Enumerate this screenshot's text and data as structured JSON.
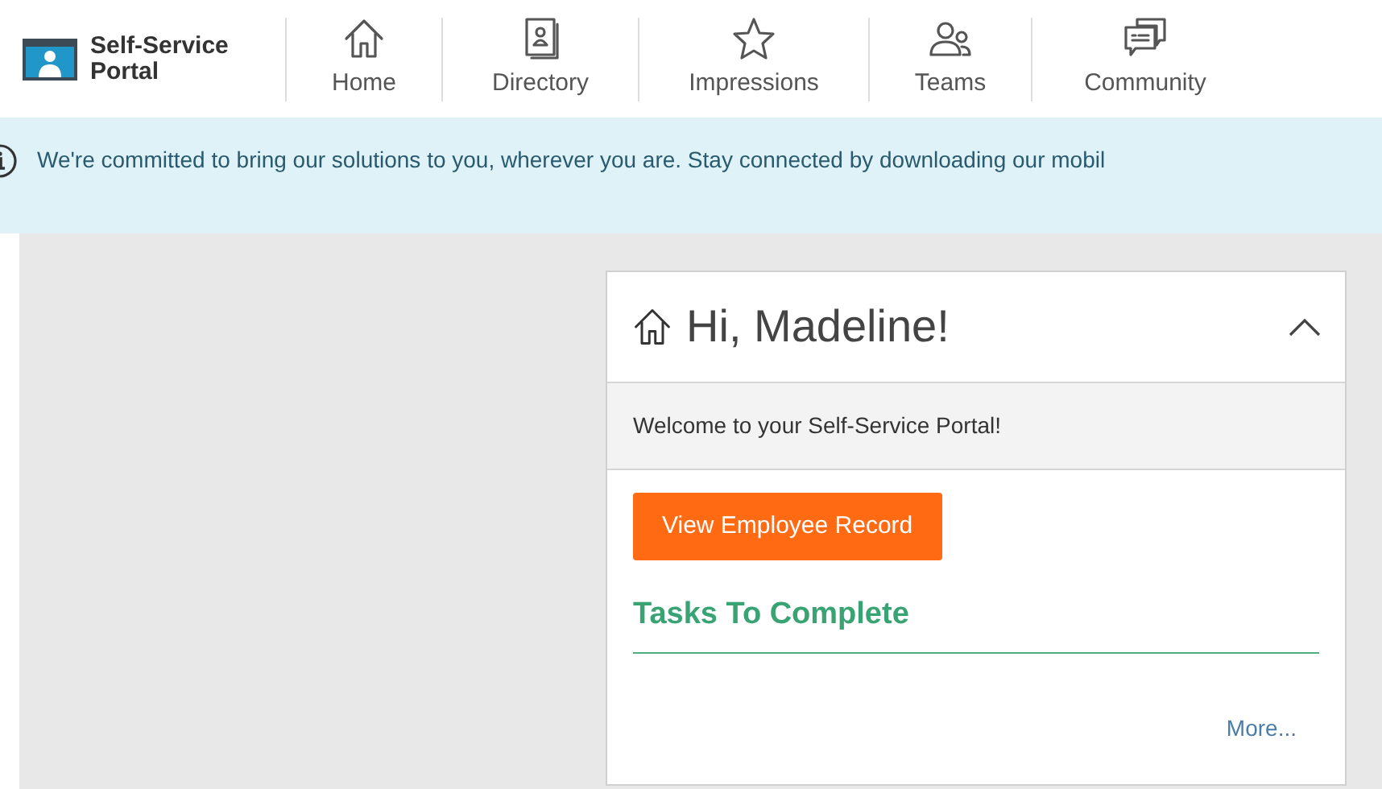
{
  "brand": {
    "name": "Self-Service Portal"
  },
  "nav": [
    {
      "kind": "home",
      "label": "Home"
    },
    {
      "kind": "directory",
      "label": "Directory"
    },
    {
      "kind": "star",
      "label": "Impressions"
    },
    {
      "kind": "people",
      "label": "Teams"
    },
    {
      "kind": "chat",
      "label": "Community"
    }
  ],
  "banner": {
    "text": "We're committed to bring our solutions to you, wherever you are. Stay connected by downloading our mobil"
  },
  "card": {
    "title": "Hi, Madeline!",
    "expanded": true,
    "welcome": "Welcome to your Self-Service Portal!",
    "button": "View Employee Record",
    "section_title": "Tasks To Complete",
    "more_link": "More..."
  }
}
